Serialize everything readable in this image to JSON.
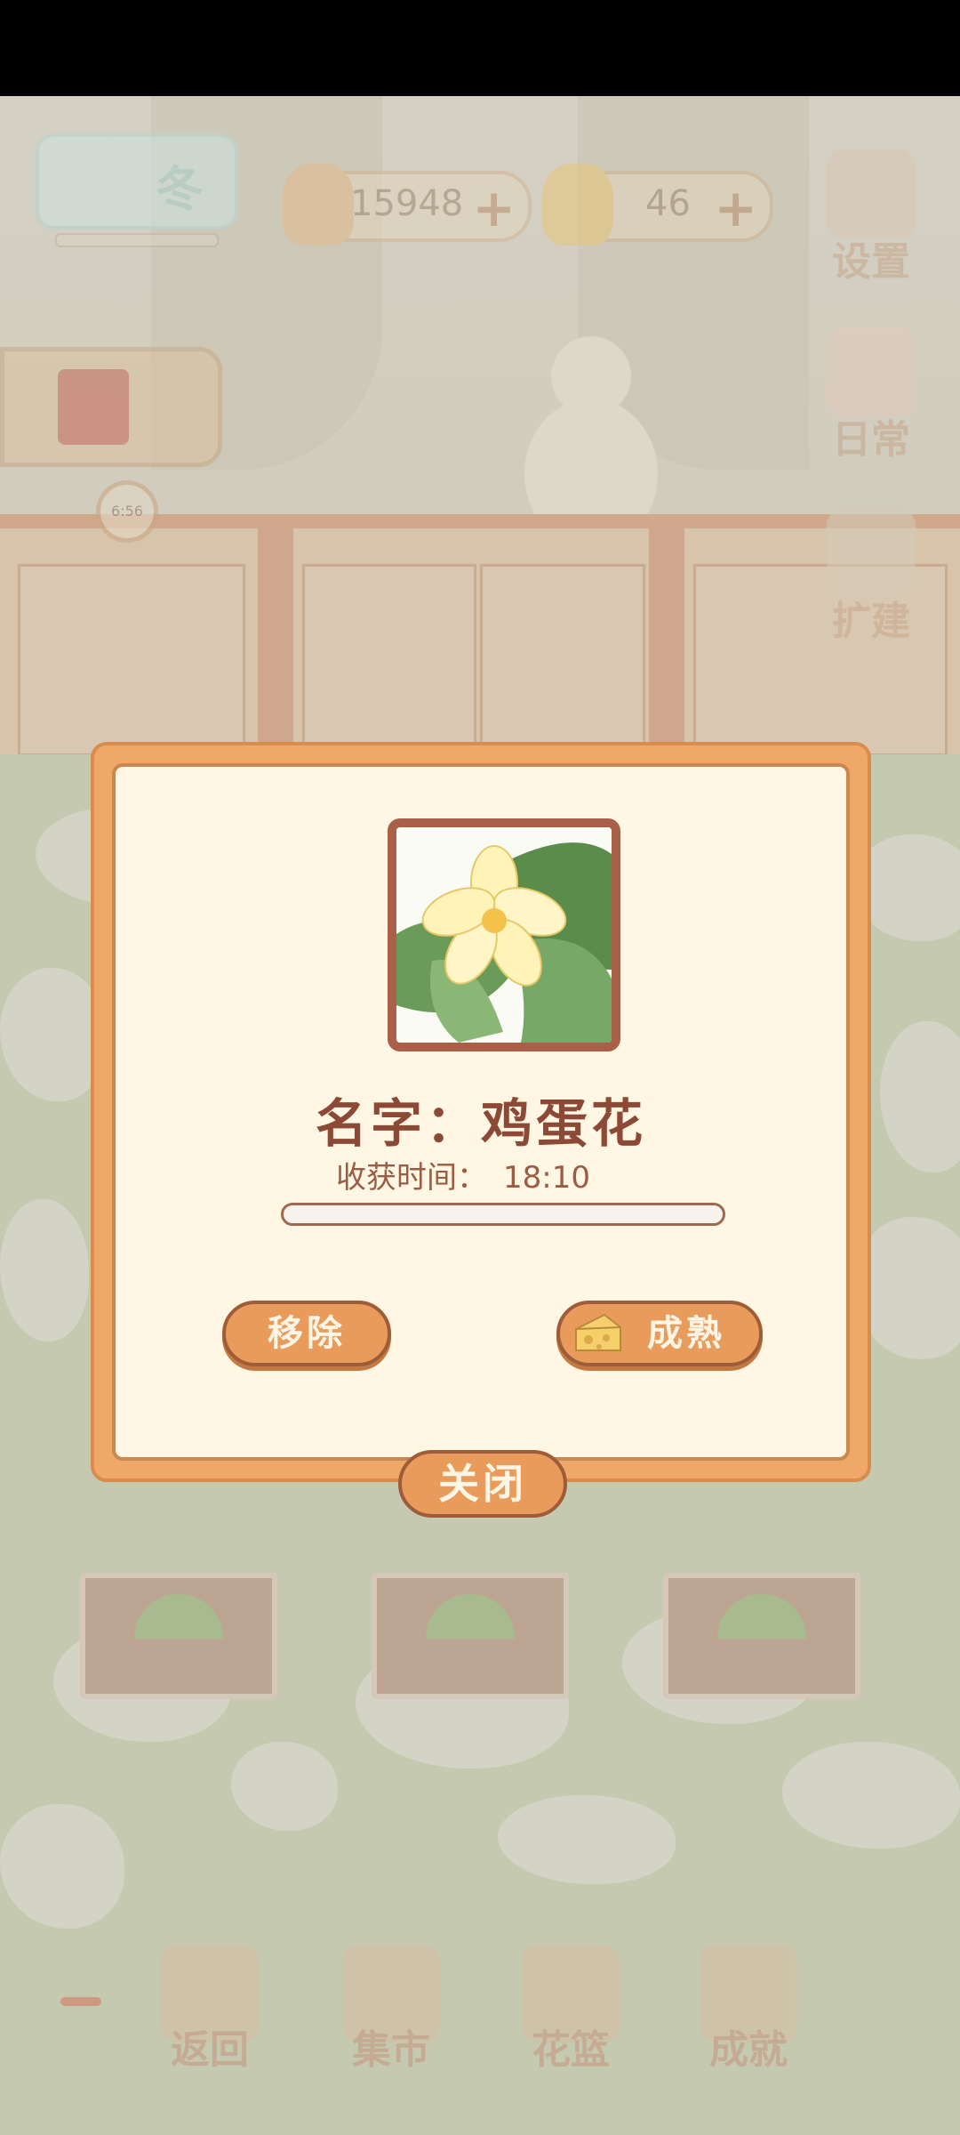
{
  "hud": {
    "season_label": "冬",
    "fish_count": "15948",
    "cheese_count": "46",
    "plus_symbol": "+",
    "clock_time": "6:56"
  },
  "side_buttons": [
    {
      "label": "设置",
      "icon": "gear-icon"
    },
    {
      "label": "日常",
      "icon": "notepad-icon"
    },
    {
      "label": "扩建",
      "icon": "hammer-icon"
    }
  ],
  "bottom_nav": [
    {
      "label": "返回",
      "icon": "window-icon"
    },
    {
      "label": "集市",
      "icon": "market-stall-icon"
    },
    {
      "label": "花篮",
      "icon": "basket-icon"
    },
    {
      "label": "成就",
      "icon": "trophy-icon"
    }
  ],
  "dialog": {
    "plant_name": "名字：鸡蛋花",
    "harvest_label": "收获时间：",
    "harvest_time": "18:10",
    "progress": 0.0,
    "remove_label": "移除",
    "mature_label": "成熟",
    "close_label": "关闭"
  },
  "colors": {
    "dialog_border": "#f0a869",
    "dialog_bg": "#fff6e3",
    "button": "#e89b5b",
    "title_text": "#8c4a36"
  }
}
